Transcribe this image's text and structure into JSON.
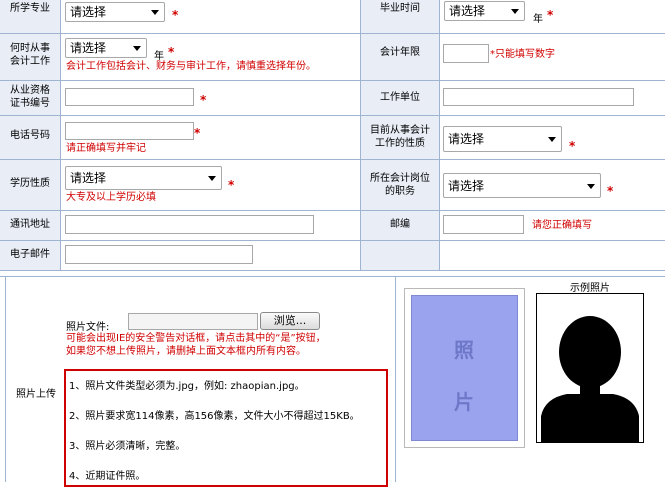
{
  "form": {
    "required_mark": "*",
    "select_default": "请选择",
    "unit_year": "年",
    "rows": {
      "major_label": "所学专业",
      "grad_time_label": "毕业时间",
      "work_years_label": "何时从事会计工作",
      "work_years_note": "会计工作包括会计、财务与审计工作，请慎重选择年份。",
      "accounting_years_label": "会计年限",
      "accounting_years_note": "*只能填写数字",
      "cert_no_label": "从业资格证书编号",
      "employer_label": "工作单位",
      "phone_label": "电话号码",
      "phone_note": "请正确填写并牢记",
      "job_nature_label": "目前从事会计工作的性质",
      "edu_nature_label": "学历性质",
      "edu_nature_note": "大专及以上学历必填",
      "position_label": "所在会计岗位的职务",
      "address_label": "通讯地址",
      "zip_label": "邮编",
      "zip_note": "请您正确填写",
      "email_label": "电子邮件"
    },
    "photo": {
      "section_label": "照片上传",
      "file_label": "照片文件:",
      "browse_button": "浏览...",
      "warning_line1": "可能会出现IE的安全警告对话框，请点击其中的“是”按钮，",
      "warning_line2": "如果您不想上传照片，请删掉上面文本框内所有内容。",
      "rules": [
        "1、照片文件类型必须为.jpg，例如:  zhaopian.jpg。",
        "2、照片要求宽114像素，高156像素，文件大小不得超过15KB。",
        "3、照片必须清晰，完整。",
        "4、近期证件照。"
      ],
      "placeholder_chars": [
        "照",
        "片"
      ],
      "sample_title": "示例照片"
    }
  },
  "colors": {
    "grid": "#9fb4d0",
    "label_bg": "#e8edf6",
    "required": "#d00000",
    "rules_border": "#d00000",
    "photo_fill": "#9aa4ee"
  }
}
